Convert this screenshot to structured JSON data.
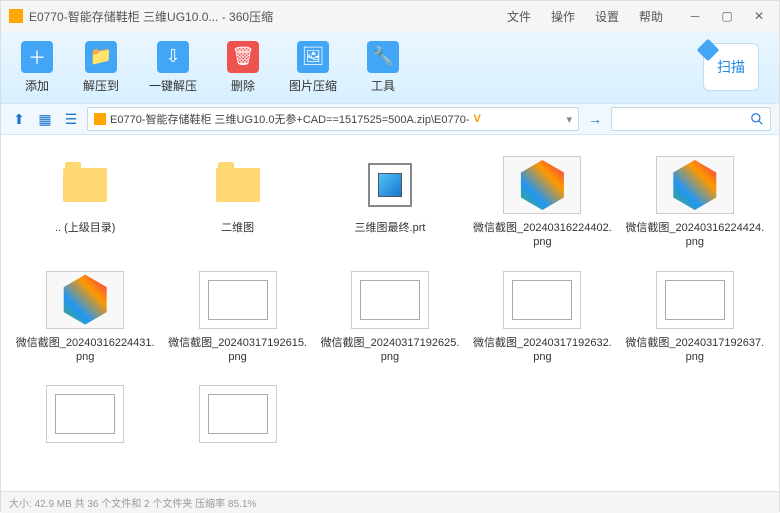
{
  "title": "E0770-智能存储鞋柜 三维UG10.0... - 360压缩",
  "menu": {
    "file": "文件",
    "operation": "操作",
    "settings": "设置",
    "help": "帮助"
  },
  "toolbar": {
    "add": "添加",
    "extract": "解压到",
    "oneclick": "一键解压",
    "delete": "删除",
    "image": "图片压缩",
    "tools": "工具",
    "scan": "扫描"
  },
  "path": "E0770-智能存储鞋柜 三维UG10.0无参+CAD==1517525=500A.zip\\E0770-",
  "items": [
    {
      "type": "folder",
      "label": ".. (上级目录)"
    },
    {
      "type": "folder",
      "label": "二维图"
    },
    {
      "type": "prt",
      "label": "三维图最终.prt"
    },
    {
      "type": "hex3d",
      "label": "微信截图_20240316224402.png"
    },
    {
      "type": "hex3d",
      "label": "微信截图_20240316224424.png"
    },
    {
      "type": "hex3d",
      "label": "微信截图_20240316224431.png"
    },
    {
      "type": "draw",
      "label": "微信截图_20240317192615.png"
    },
    {
      "type": "draw",
      "label": "微信截图_20240317192625.png"
    },
    {
      "type": "draw",
      "label": "微信截图_20240317192632.png"
    },
    {
      "type": "draw",
      "label": "微信截图_20240317192637.png"
    },
    {
      "type": "draw",
      "label": ""
    },
    {
      "type": "draw",
      "label": ""
    }
  ],
  "status": "大小: 42.9 MB 共 36 个文件和 2 个文件夹 压缩率 85.1%"
}
